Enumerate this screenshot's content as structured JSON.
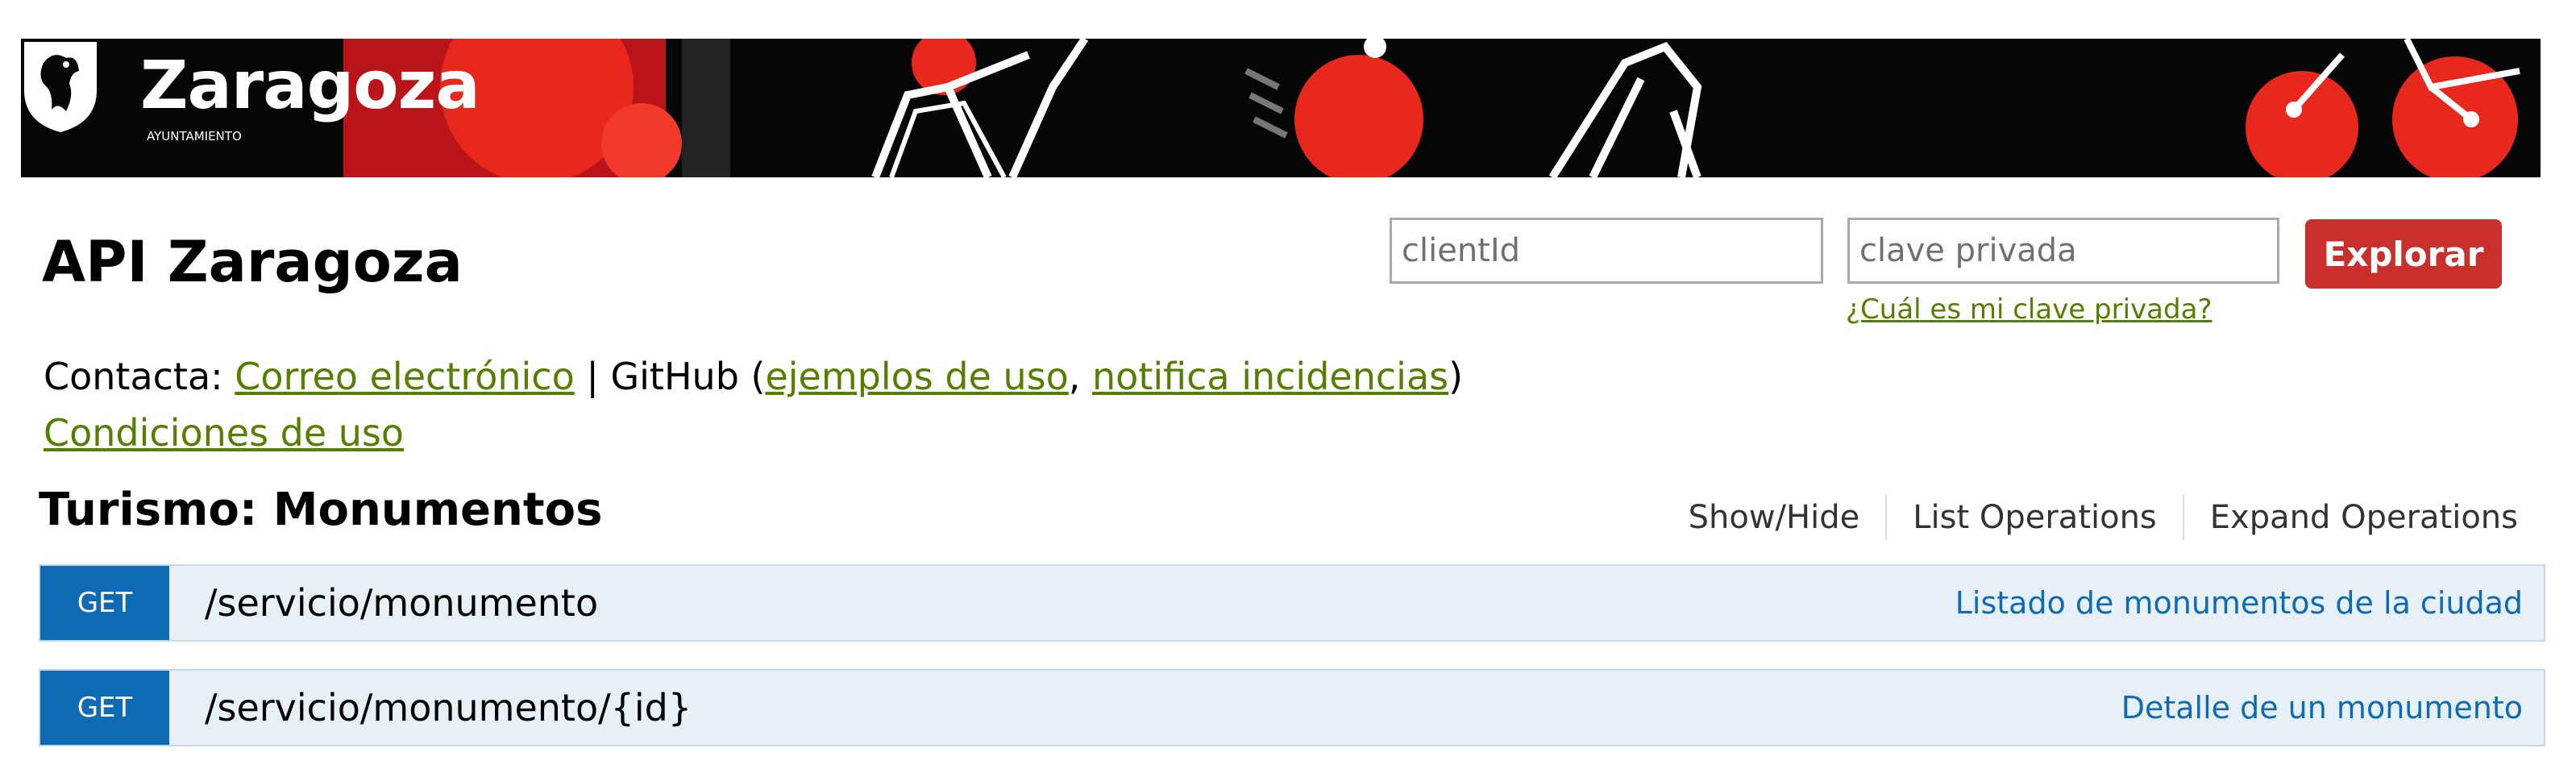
{
  "banner": {
    "logo_text": "Zaragoza",
    "logo_subtext": "AYUNTAMIENTO",
    "colors": {
      "accent": "#e8281c",
      "background": "#060606"
    }
  },
  "header": {
    "title": "API Zaragoza",
    "client_id_placeholder": "clientId",
    "private_key_placeholder": "clave privada",
    "explore_label": "Explorar",
    "private_key_help": "¿Cuál es mi clave privada?"
  },
  "contact": {
    "prefix": "Contacta: ",
    "email_link": "Correo electrónico",
    "separator": " | GitHub (",
    "examples_link": "ejemplos de uso",
    "comma": ", ",
    "issues_link": "notifica incidencias",
    "suffix": ")",
    "terms_link": "Condiciones de uso"
  },
  "section": {
    "title": "Turismo: Monumentos",
    "operations": [
      "Show/Hide",
      "List Operations",
      "Expand Operations"
    ]
  },
  "endpoints": [
    {
      "method": "GET",
      "path": "/servicio/monumento",
      "description": "Listado de monumentos de la ciudad"
    },
    {
      "method": "GET",
      "path": "/servicio/monumento/{id}",
      "description": "Detalle de un monumento"
    }
  ],
  "colors": {
    "link": "#547f00",
    "get_method": "#0f6ab4",
    "endpoint_bg": "#e7f0f7",
    "explore_button": "#c9302c"
  }
}
